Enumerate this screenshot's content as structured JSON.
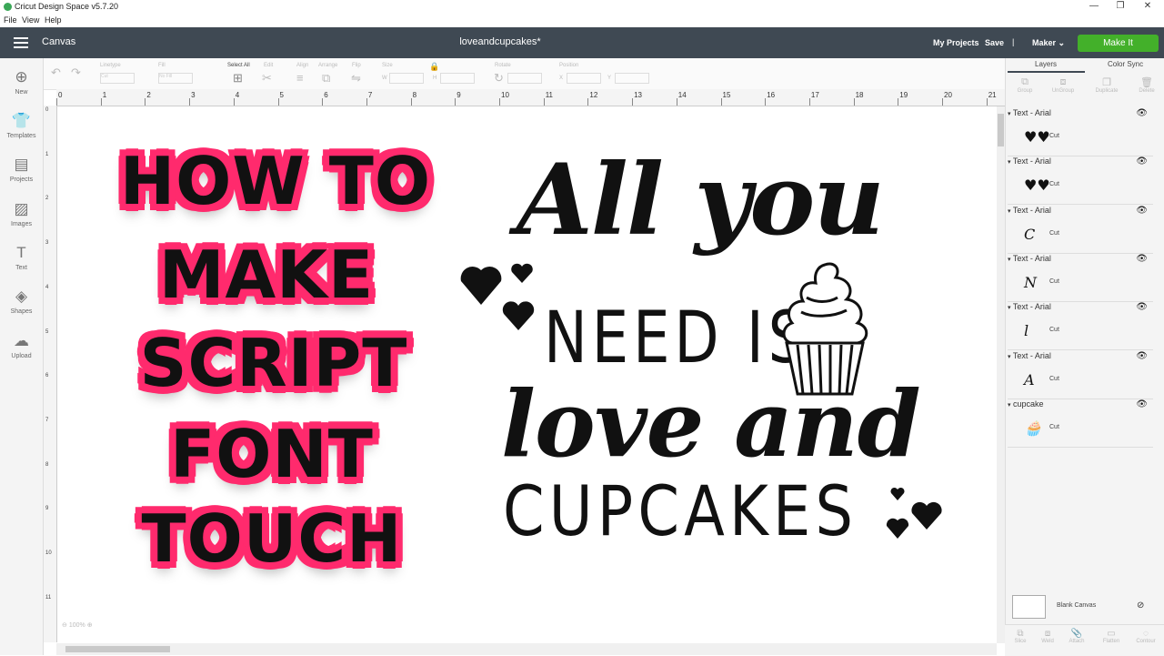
{
  "window": {
    "title": "Cricut Design Space  v5.7.20",
    "minimize": "—",
    "restore": "❐",
    "close": "✕"
  },
  "menu": [
    "File",
    "View",
    "Help"
  ],
  "header": {
    "section": "Canvas",
    "project_name": "loveandcupcakes*",
    "my_projects": "My Projects",
    "save": "Save",
    "separator": "|",
    "machine": "Maker",
    "make_it": "Make It",
    "accent": "#43b02a",
    "bar_color": "#3f4953"
  },
  "left_tools": [
    {
      "label": "New",
      "icon": "plus-circle-icon"
    },
    {
      "label": "Templates",
      "icon": "shirt-icon"
    },
    {
      "label": "Projects",
      "icon": "projects-icon"
    },
    {
      "label": "Images",
      "icon": "image-icon"
    },
    {
      "label": "Text",
      "icon": "text-icon"
    },
    {
      "label": "Shapes",
      "icon": "shapes-icon"
    },
    {
      "label": "Upload",
      "icon": "upload-icon"
    }
  ],
  "toolbar": {
    "linetype_label": "Linetype",
    "linetype_value": "Cut",
    "fill_label": "Fill",
    "fill_value": "No Fill",
    "select_all": "Select All",
    "edit": "Edit",
    "align": "Align",
    "arrange": "Arrange",
    "flip": "Flip",
    "size": "Size",
    "w": "W",
    "h": "H",
    "rotate": "Rotate",
    "position": "Position",
    "x": "X",
    "y": "Y"
  },
  "ruler_top": [
    "0",
    "1",
    "2",
    "3",
    "4",
    "5",
    "6",
    "7",
    "8",
    "9",
    "10",
    "11",
    "12",
    "13",
    "14",
    "15",
    "16",
    "17",
    "18",
    "19",
    "20",
    "21"
  ],
  "ruler_left": [
    "0",
    "1",
    "2",
    "3",
    "4",
    "5",
    "6",
    "7",
    "8",
    "9",
    "10",
    "11"
  ],
  "canvas": {
    "thumb_lines": [
      "HOW TO",
      "MAKE",
      "SCRIPT",
      "FONT",
      "TOUCH"
    ],
    "thumb_accent": "#ff2a6d",
    "design_line1": "All you",
    "design_line2": "NEED IS",
    "design_line3": "love and",
    "design_line4": "CUPCAKES",
    "zoom": "100%"
  },
  "right_panel": {
    "tabs": [
      "Layers",
      "Color Sync"
    ],
    "top_actions": [
      "Group",
      "UnGroup",
      "Duplicate",
      "Delete"
    ],
    "layers": [
      {
        "name": "Text - Arial",
        "glyph": "♥♥",
        "op": "Cut"
      },
      {
        "name": "Text - Arial",
        "glyph": "♥♥",
        "op": "Cut"
      },
      {
        "name": "Text - Arial",
        "glyph": "C",
        "op": "Cut"
      },
      {
        "name": "Text - Arial",
        "glyph": "N",
        "op": "Cut"
      },
      {
        "name": "Text - Arial",
        "glyph": "l",
        "op": "Cut"
      },
      {
        "name": "Text - Arial",
        "glyph": "A",
        "op": "Cut"
      },
      {
        "name": "cupcake",
        "glyph": "🧁",
        "op": "Cut"
      }
    ],
    "blank_canvas": "Blank Canvas",
    "bottom_actions": [
      "Slice",
      "Weld",
      "Attach",
      "Flatten",
      "Contour"
    ]
  }
}
